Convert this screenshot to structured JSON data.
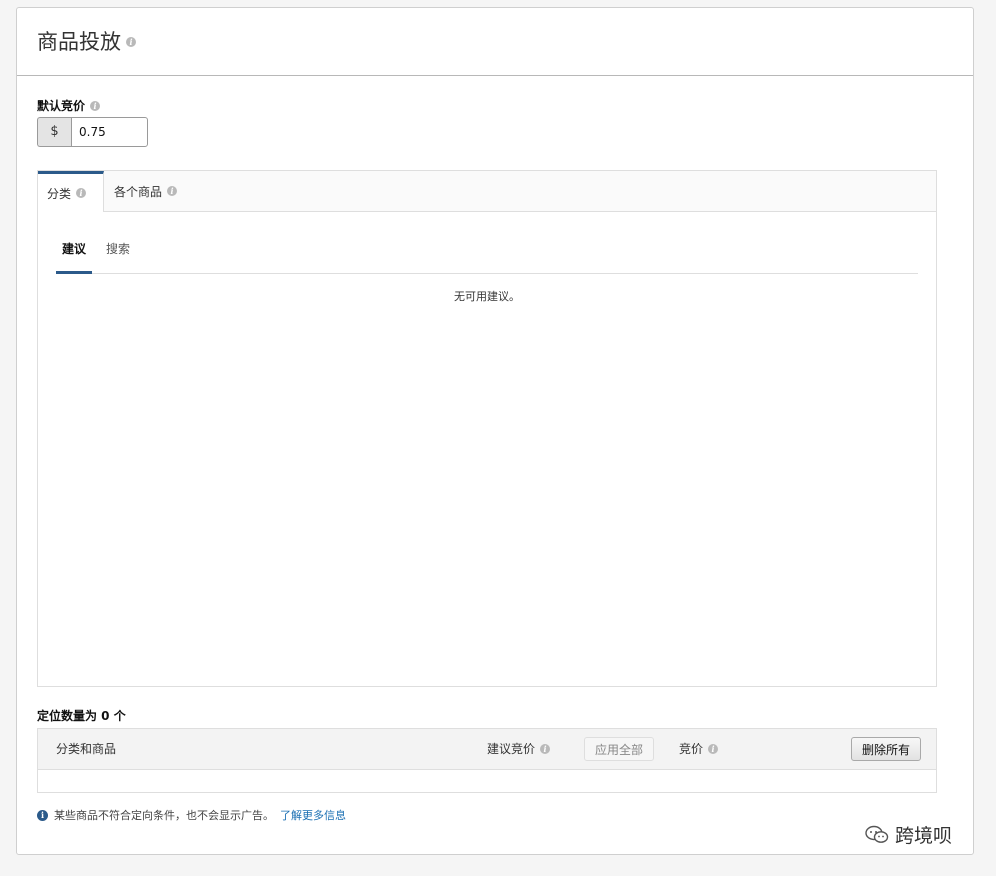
{
  "header": {
    "title": "商品投放"
  },
  "default_bid": {
    "label": "默认竞价",
    "currency": "$",
    "value": "0.75"
  },
  "tabs": [
    {
      "label": "分类",
      "active": true
    },
    {
      "label": "各个商品",
      "active": false
    }
  ],
  "subtabs": [
    {
      "label": "建议",
      "active": true
    },
    {
      "label": "搜索",
      "active": false
    }
  ],
  "suggestions": {
    "empty_message": "无可用建议。"
  },
  "targets": {
    "count_label": "定位数量为 0 个",
    "columns": {
      "category_product": "分类和商品",
      "suggested_bid": "建议竞价",
      "bid": "竞价"
    },
    "apply_all_label": "应用全部",
    "remove_all_label": "删除所有"
  },
  "footnote": {
    "text": "某些商品不符合定向条件，也不会显示广告。",
    "link": "了解更多信息"
  },
  "watermark": {
    "text": "跨境呗"
  },
  "colors": {
    "accent": "#2b5a8a",
    "link": "#1a6fb3"
  }
}
